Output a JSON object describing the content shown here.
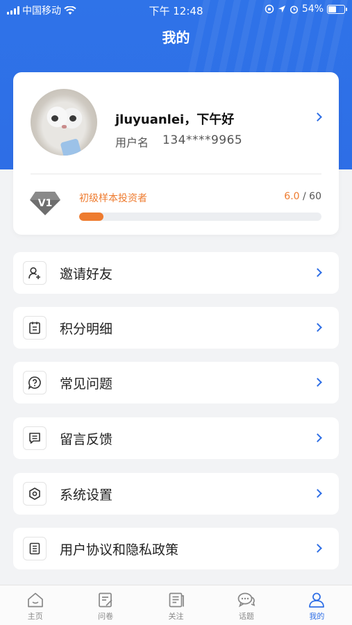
{
  "status_bar": {
    "carrier": "中国移动",
    "time": "下午 12:48",
    "battery": "54%",
    "battery_level": 0.54
  },
  "header": {
    "title": "我的"
  },
  "profile": {
    "greeting": "jluyuanlei，下午好",
    "username_label": "用户名",
    "phone": "134****9965",
    "level_badge": "V1",
    "level_name": "初级样本投资者",
    "score_current": "6.0",
    "score_total": "60",
    "progress_fraction": 0.1
  },
  "menu": [
    {
      "label": "邀请好友",
      "icon": "invite-user-icon"
    },
    {
      "label": "积分明细",
      "icon": "points-list-icon"
    },
    {
      "label": "常见问题",
      "icon": "question-icon"
    },
    {
      "label": "留言反馈",
      "icon": "message-icon"
    },
    {
      "label": "系统设置",
      "icon": "settings-icon"
    },
    {
      "label": "用户协议和隐私政策",
      "icon": "agreement-icon"
    }
  ],
  "tabs": [
    {
      "label": "主页",
      "icon": "home-icon",
      "active": false
    },
    {
      "label": "问卷",
      "icon": "survey-icon",
      "active": false
    },
    {
      "label": "关注",
      "icon": "follow-icon",
      "active": false
    },
    {
      "label": "话题",
      "icon": "topic-icon",
      "active": false
    },
    {
      "label": "我的",
      "icon": "profile-icon",
      "active": true
    }
  ],
  "colors": {
    "brand_blue": "#2e6ee6",
    "accent_orange": "#ee7b2f",
    "background": "#f2f3f5"
  }
}
